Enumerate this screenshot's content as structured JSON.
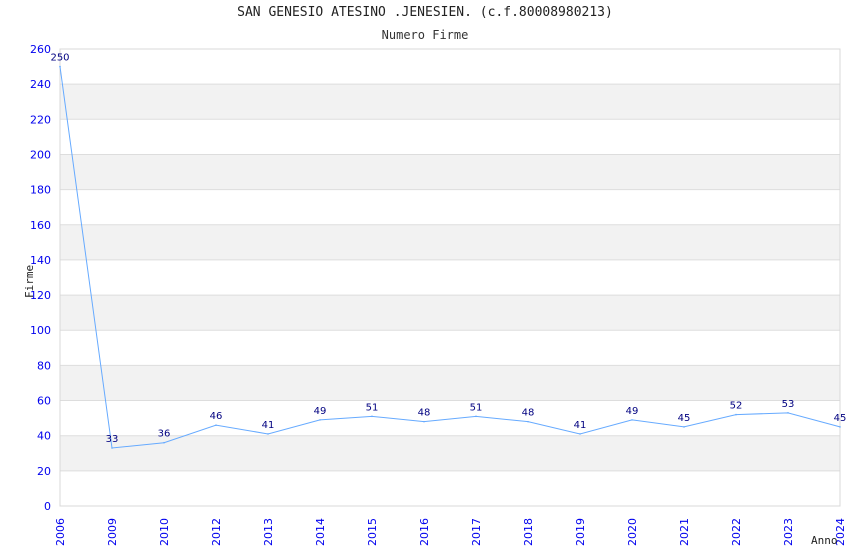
{
  "chart_data": {
    "type": "line",
    "title": "SAN GENESIO ATESINO .JENESIEN. (c.f.80008980213)",
    "subtitle": "Numero Firme",
    "xlabel": "Anno",
    "ylabel": "Firme",
    "categories": [
      "2006",
      "2009",
      "2010",
      "2012",
      "2013",
      "2014",
      "2015",
      "2016",
      "2017",
      "2018",
      "2019",
      "2020",
      "2021",
      "2022",
      "2023",
      "2024"
    ],
    "values": [
      250,
      33,
      36,
      46,
      41,
      49,
      51,
      48,
      51,
      48,
      41,
      49,
      45,
      52,
      53,
      45
    ],
    "ylim": [
      0,
      260
    ],
    "yticks": [
      0,
      20,
      40,
      60,
      80,
      100,
      120,
      140,
      160,
      180,
      200,
      220,
      240,
      260
    ],
    "grid": true,
    "line_color": "#66aaff",
    "tick_color": "#0000ee",
    "label_color": "#000080"
  }
}
